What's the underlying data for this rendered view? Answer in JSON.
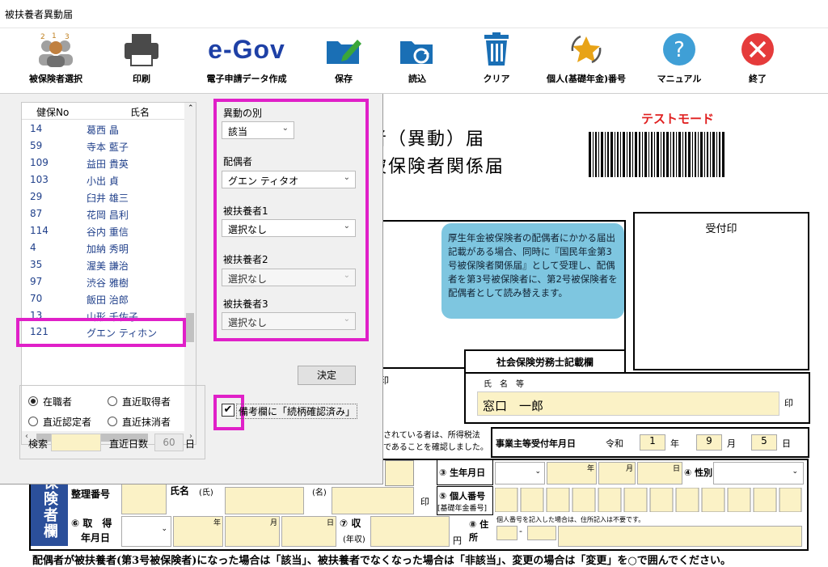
{
  "window": {
    "title": "被扶養者異動届"
  },
  "toolbar": {
    "select_insured": "被保険者選択",
    "print": "印刷",
    "egov_logo": "e-Gov",
    "egov": "電子申請データ作成",
    "save": "保存",
    "load": "読込",
    "clear": "クリア",
    "personal_number": "個人(基礎年金)番号",
    "manual": "マニュアル",
    "exit": "終了"
  },
  "list": {
    "header_no": "健保No",
    "header_name": "氏名",
    "rows": [
      {
        "no": "14",
        "name": "葛西 晶"
      },
      {
        "no": "59",
        "name": "寺本 藍子"
      },
      {
        "no": "109",
        "name": "益田 貴英"
      },
      {
        "no": "103",
        "name": "小出 貞"
      },
      {
        "no": "29",
        "name": "臼井 雄三"
      },
      {
        "no": "87",
        "name": "花岡 昌利"
      },
      {
        "no": "114",
        "name": "谷内 重信"
      },
      {
        "no": "4",
        "name": "加納 秀明"
      },
      {
        "no": "35",
        "name": "渥美 謙治"
      },
      {
        "no": "97",
        "name": "渋谷 雅樹"
      },
      {
        "no": "70",
        "name": "飯田 治郎"
      },
      {
        "no": "13",
        "name": "山形 千佐子"
      },
      {
        "no": "121",
        "name": "グエン ティホン"
      }
    ]
  },
  "change": {
    "type_label": "異動の別",
    "type_value": "該当",
    "spouse_label": "配偶者",
    "spouse_value": "グエン ティタオ",
    "dep1_label": "被扶養者1",
    "dep1_value": "選択なし",
    "dep2_label": "被扶養者2",
    "dep2_value": "選択なし",
    "dep3_label": "被扶養者3",
    "dep3_value": "選択なし",
    "confirm": "決定"
  },
  "filter": {
    "employed": "在職者",
    "recent_acquired": "直近取得者",
    "recent_certified": "直近認定者",
    "recent_lost": "直近抹消者",
    "search_label": "検索",
    "search_value": "",
    "days_label": "直近日数",
    "days_value": "60",
    "days_unit": "日"
  },
  "remarks_check": {
    "label": "備考欄に「続柄確認済み」",
    "checked": true
  },
  "form": {
    "title1": "者（異動）届",
    "title2": "被保険者関係届",
    "test_mode": "テストモード",
    "reception_stamp": "受付印",
    "note": "厚生年金被保険者の配偶者にかかる届出記載がある場合、同時に『国民年金第3号被保険者関係届』として受理し、配偶者を第3号被保険者に、第2号被保険者を配偶者として読み替えます。",
    "sharoushi": "社会保険労務士記載欄",
    "name_label": "氏　名　等",
    "name_value": "窓口　一郎",
    "seal": "印",
    "income_note1": "されている者は、所得税法",
    "income_note2": "であることを確認しました。",
    "receipt_date_label": "事業主等受付年月日",
    "era": "令和",
    "year_value": "1",
    "year_unit": "年",
    "month_value": "9",
    "month_unit": "月",
    "day_value": "5",
    "day_unit": "日",
    "birth_label": "③ 生年月日",
    "gender_label": "④ 性別",
    "year_s": "年",
    "month_s": "月",
    "day_s": "日",
    "seiri_label": "整理番号",
    "shimei_label": "氏名",
    "shi": "(氏)",
    "mei": "(名)",
    "kojin_label": "⑤ 個人番号",
    "kojin_sub": "[基礎年金番号]",
    "side_label": "保険者欄",
    "acq_label": "⑥ 取　得",
    "acq_sub": "年月日",
    "income_label": "⑦ 収　入",
    "income_sub": "(年収)",
    "yen": "円",
    "address_label": "⑧ 住所",
    "address_note": "個人番号を記入した場合は、住所記入は不要です。",
    "bottom_text": "配偶者が被扶養者(第3号被保険者)になった場合は「該当」、被扶養者でなくなった場合は「非該当」、変更の場合は「変更」を○で囲んでください。"
  },
  "colors": {
    "accent_magenta": "#e020c8",
    "list_text": "#1f3f8a",
    "form_yellow": "#fbf2c6",
    "note_blue": "#7ec6e0",
    "test_red": "#e02020"
  }
}
